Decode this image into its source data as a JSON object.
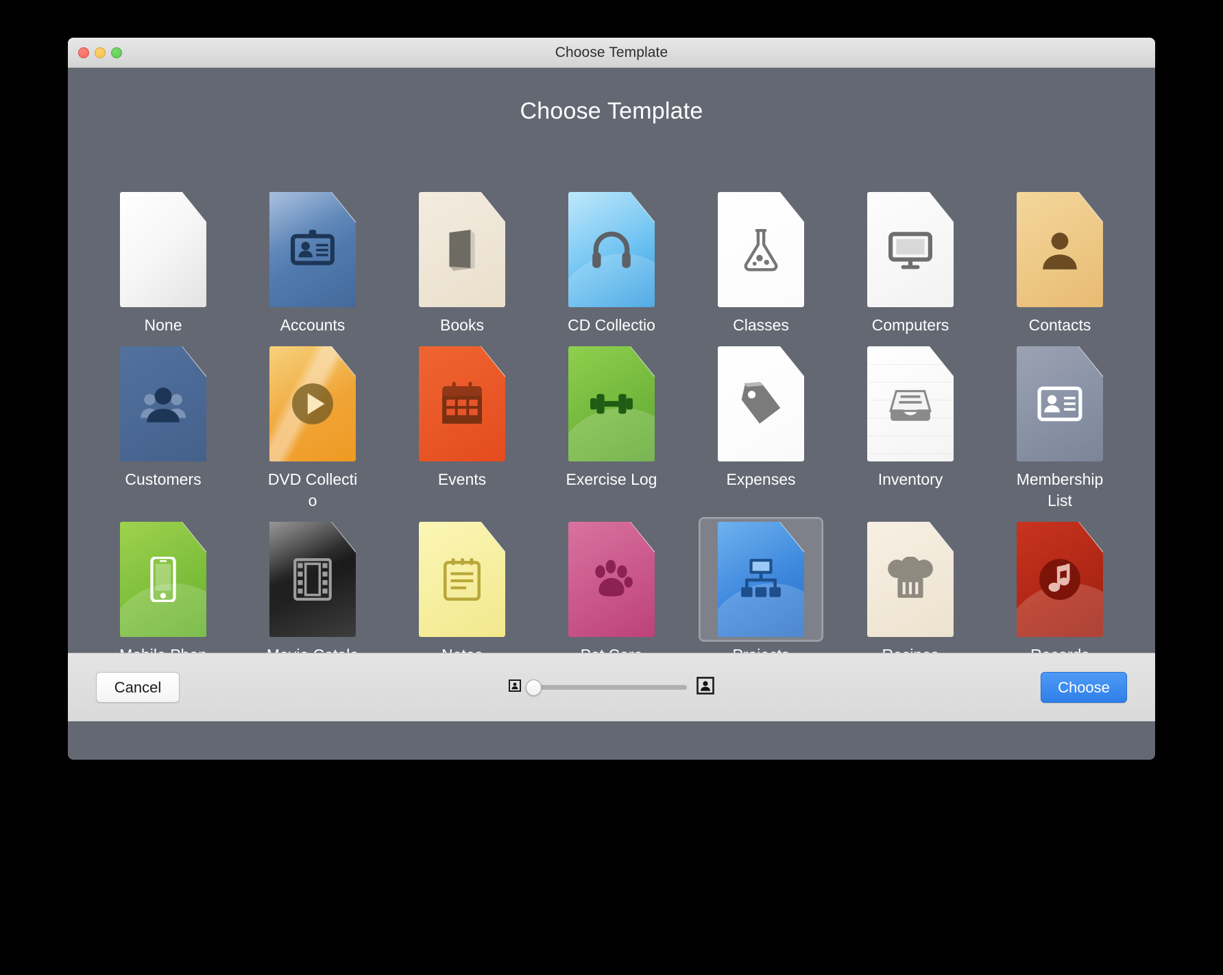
{
  "window": {
    "title": "Choose Template",
    "heading": "Choose Template",
    "background_color": "#646873",
    "traffic_lights": [
      "close",
      "minimize",
      "zoom"
    ]
  },
  "templates": [
    {
      "label": "None",
      "icon": "blank-page-icon",
      "color": "#f5f5f5"
    },
    {
      "label": "Accounts",
      "icon": "id-badge-icon",
      "color": "#5c84b8"
    },
    {
      "label": "Books",
      "icon": "book-icon",
      "color": "#eee6d4"
    },
    {
      "label": "CD Collectio",
      "icon": "headphones-icon",
      "color": "#8fd3f6"
    },
    {
      "label": "Classes",
      "icon": "flask-icon",
      "color": "#ffffff"
    },
    {
      "label": "Computers",
      "icon": "monitor-icon",
      "color": "#f7f7f7"
    },
    {
      "label": "Contacts",
      "icon": "person-icon",
      "color": "#edc480"
    },
    {
      "label": "Customers",
      "icon": "people-group-icon",
      "color": "#4a6fa5"
    },
    {
      "label": "DVD Collectio",
      "icon": "play-circle-icon",
      "color": "#f2a53c"
    },
    {
      "label": "Events",
      "icon": "calendar-icon",
      "color": "#e8552a"
    },
    {
      "label": "Exercise Log",
      "icon": "dumbbell-icon",
      "color": "#76bf43"
    },
    {
      "label": "Expenses",
      "icon": "price-tag-icon",
      "color": "#ffffff"
    },
    {
      "label": "Inventory",
      "icon": "file-tray-icon",
      "color": "#fafafa"
    },
    {
      "label": "Membership List",
      "icon": "contact-card-icon",
      "color": "#8991a4"
    },
    {
      "label": "Mobile Phones",
      "icon": "smartphone-icon",
      "color": "#8dc63f"
    },
    {
      "label": "Movie Catalog",
      "icon": "film-strip-icon",
      "color": "#2b2b2b"
    },
    {
      "label": "Notes",
      "icon": "notepad-icon",
      "color": "#f7f0a8"
    },
    {
      "label": "Pet Care",
      "icon": "paw-print-icon",
      "color": "#cf5a91"
    },
    {
      "label": "Projects",
      "icon": "org-chart-icon",
      "color": "#3d8ae0"
    },
    {
      "label": "Recipes",
      "icon": "chef-hat-icon",
      "color": "#f3ebdd"
    },
    {
      "label": "Records",
      "icon": "music-note-icon",
      "color": "#b02718"
    },
    {
      "label": "",
      "icon": "partial-cream-icon",
      "color": "#f0e9db"
    },
    {
      "label": "",
      "icon": "partial-green-icon",
      "color": "#2f7a22"
    }
  ],
  "selected_template": "Projects",
  "toolbar": {
    "cancel_label": "Cancel",
    "choose_label": "Choose",
    "slider_small_icon": "small-icon-size-icon",
    "slider_large_icon": "large-icon-size-icon",
    "slider_value": 0,
    "accent_color": "#2f7fe8"
  }
}
